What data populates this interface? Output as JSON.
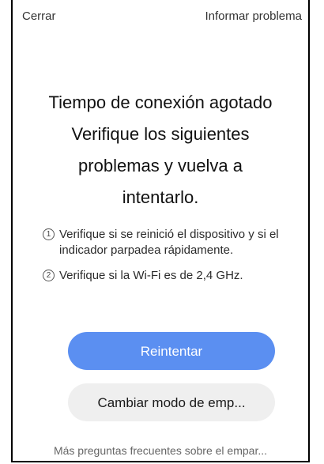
{
  "header": {
    "close_label": "Cerrar",
    "report_label": "Informar problema"
  },
  "title_lines": [
    "Tiempo de conexión agotado",
    "Verifique los siguientes",
    "problemas y vuelva a",
    "intentarlo."
  ],
  "tips": [
    {
      "num": "1",
      "text": "Verifique si se reinició el dispositivo y si el indicador parpadea rápidamente."
    },
    {
      "num": "2",
      "text": "Verifique si la Wi-Fi es de 2,4 GHz."
    }
  ],
  "buttons": {
    "retry_label": "Reintentar",
    "switch_mode_label": "Cambiar modo de emp..."
  },
  "footer": {
    "faq_label": "Más preguntas frecuentes sobre el empar..."
  },
  "colors": {
    "primary_button": "#5b8ff1",
    "secondary_button": "#efefef"
  }
}
